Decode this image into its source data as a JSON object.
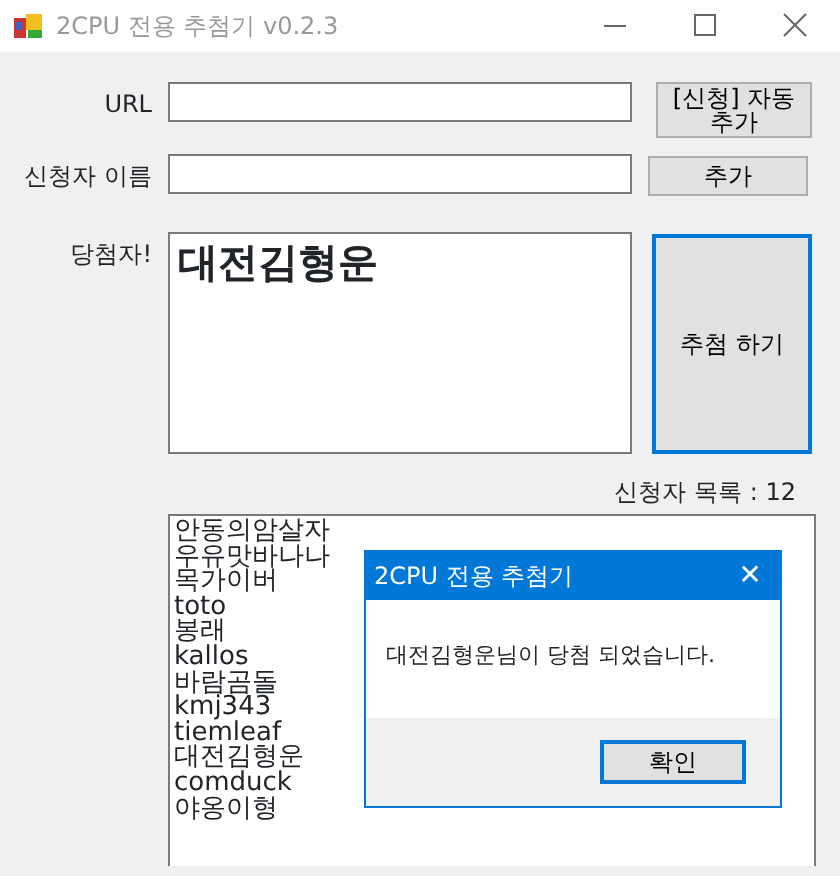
{
  "window": {
    "title": "2CPU 전용 추첨기 v0.2.3"
  },
  "url": {
    "label": "URL",
    "button": "[신청] 자동 추가"
  },
  "applicant": {
    "label": "신청자 이름",
    "button": "추가"
  },
  "winner": {
    "label": "당첨자!",
    "value": "대전김형운",
    "button": "추첨 하기",
    "button_focused": true
  },
  "list": {
    "count_label": "신청자 목록 : 12",
    "items": [
      "안동의암살자",
      "우유맛바나나",
      "목가이버",
      "toto",
      "봉래",
      "kallos",
      "바람곰돌",
      "kmj343",
      "tiemleaf",
      "대전김형운",
      "comduck",
      "야옹이형"
    ]
  },
  "dialog": {
    "title": "2CPU 전용 추첨기",
    "close": "✕",
    "message": "대전김형운님이 당첨 되었습니다.",
    "button": "확인"
  }
}
